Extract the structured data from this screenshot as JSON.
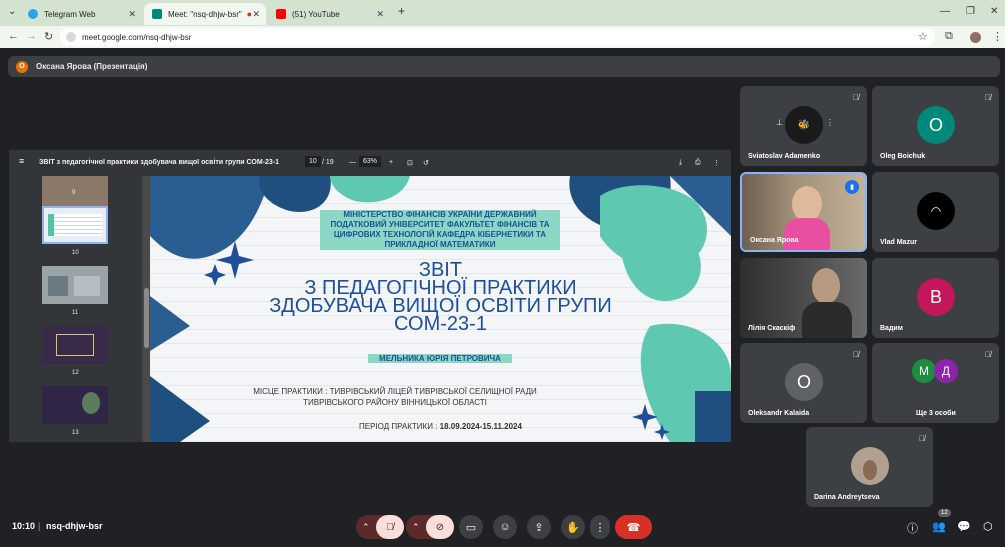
{
  "browser": {
    "tabs": [
      {
        "label": "Telegram Web",
        "favicon_color": "#2aa3ef"
      },
      {
        "label": "Meet: \"nsq-dhjw-bsr\"",
        "favicon_color": "#00897b"
      },
      {
        "label": "(51) YouTube",
        "favicon_color": "#ff0000"
      }
    ],
    "url": "meet.google.com/nsq-dhjw-bsr"
  },
  "presenter": {
    "initial": "О",
    "label": "Оксана Ярова (Презентація)"
  },
  "pdf": {
    "title": "ЗВІТ з педагогічної практики здобувача вищої освіти групи СОМ-23-1",
    "page_current": "10",
    "page_total": "/ 19",
    "zoom": "63%",
    "thumbs": [
      "9",
      "10",
      "11",
      "12",
      "13"
    ]
  },
  "slide": {
    "ministry": "МІНІСТЕРСТВО ФІНАНСІВ УКРАЇНИ ДЕРЖАВНИЙ ПОДАТКОВИЙ УНІВЕРСИТЕТ ФАКУЛЬТЕТ ФІНАНСІВ ТА ЦИФРОВИХ ТЕХНОЛОГІЙ КАФЕДРА КІБЕРНЕТИКИ ТА ПРИКЛАДНОЇ МАТЕМАТИКИ",
    "title_line1": "ЗВІТ",
    "title_line2": "З ПЕДАГОГІЧНОЇ ПРАКТИКИ",
    "title_line3": "ЗДОБУВАЧА ВИЩОЇ ОСВІТИ ГРУПИ",
    "title_line4": "СОМ-23-1",
    "author": "МЕЛЬНИКА ЮРІЯ ПЕТРОВИЧА",
    "place": "МІСЦЕ ПРАКТИКИ : ТИВРІВСЬКИЙ ЛІЦЕЙ ТИВРІВСЬКОЇ СЕЛИЩНОЇ РАДИ ТИВРІВСЬКОГО РАЙОНУ ВІННИЦЬКОЇ ОБЛАСТІ",
    "period_label": "ПЕРІОД ПРАКТИКИ :",
    "period_value": "18.09.2024-15.11.2024"
  },
  "participants": [
    {
      "name": "Sviatoslav Adamenko"
    },
    {
      "name": "Oleg Boichuk",
      "initial": "O",
      "color": "#00897b"
    },
    {
      "name": "Оксана Ярова"
    },
    {
      "name": "Vlad Mazur"
    },
    {
      "name": "Лілія Скаскіф"
    },
    {
      "name": "Вадим",
      "initial": "В",
      "color": "#c2185b"
    },
    {
      "name": "Oleksandr Kalaida",
      "initial": "O",
      "color": "#5f6368"
    },
    {
      "name": "Ще 3 особи",
      "initials": [
        "М",
        "Д"
      ],
      "colors": [
        "#1e8e3e",
        "#8e24aa"
      ]
    },
    {
      "name": "Darina Andreytseva"
    }
  ],
  "footer": {
    "time": "10:10",
    "separator": "|",
    "meeting_code": "nsq-dhjw-bsr",
    "people_count": "12"
  }
}
